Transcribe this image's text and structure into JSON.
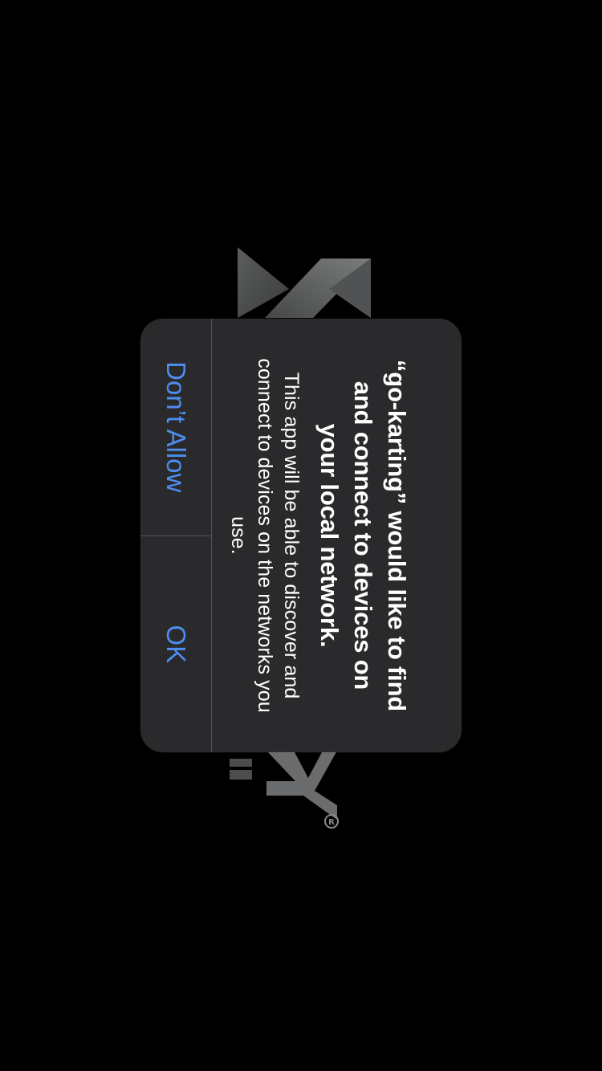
{
  "background": {
    "color": "#000000",
    "logo_icon": "origami-k-logo",
    "wordmark_icon": "partial-wordmark"
  },
  "alert": {
    "title": "“go-karting” would like to find and connect to devices on your local network.",
    "message": "This app will be able to discover and connect to devices on the networks you use.",
    "buttons": [
      {
        "label": "Don’t Allow"
      },
      {
        "label": "OK"
      }
    ],
    "accent_color": "#4d8ef0"
  }
}
